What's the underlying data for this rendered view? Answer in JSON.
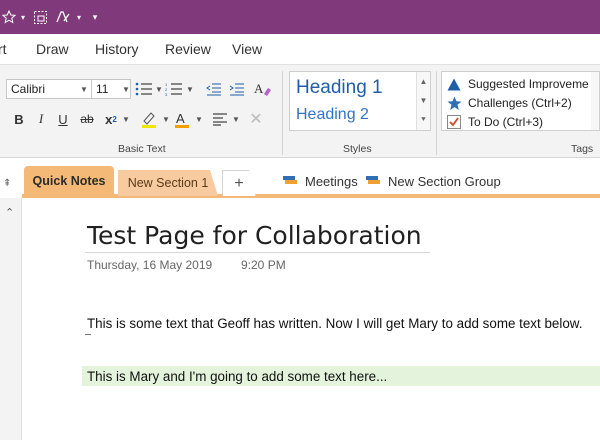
{
  "quick_access": {
    "star_icon": "star-dropdown-icon",
    "screen_clip_icon": "screen-clip-icon",
    "pen_icon": "pen-dropdown-icon",
    "customize_icon": "customize-dropdown-icon"
  },
  "menu": {
    "tabs": [
      "rt",
      "Draw",
      "History",
      "Review",
      "View"
    ]
  },
  "ribbon": {
    "basic_text": {
      "font_name": "Calibri",
      "font_size": "11",
      "label": "Basic Text",
      "bold": "B",
      "italic": "I",
      "underline": "U",
      "strike": "ab",
      "subscript": "x",
      "subscript_small": "2",
      "highlight_color": "#f2e600",
      "font_color": "#f2a000"
    },
    "styles": {
      "heading1": "Heading 1",
      "heading2": "Heading 2",
      "label": "Styles"
    },
    "tags": {
      "items": [
        {
          "label": "Suggested Improveme",
          "icon": "triangle-icon",
          "color": "#1f5ea8"
        },
        {
          "label": "Challenges (Ctrl+2)",
          "icon": "star-icon",
          "color": "#2f6fb6"
        },
        {
          "label": "To Do (Ctrl+3)",
          "icon": "checkbox-icon",
          "color": "#d24726"
        }
      ],
      "label": "Tags"
    }
  },
  "sections": {
    "pin": "⇞",
    "tabs": [
      {
        "label": "Quick Notes",
        "color": "#f5b977"
      },
      {
        "label": "New Section 1",
        "color": "#f8caa0"
      }
    ],
    "add_label": "+",
    "links": [
      {
        "label": "Meetings"
      },
      {
        "label": "New Section Group"
      }
    ]
  },
  "page": {
    "title": "Test Page for Collaboration",
    "date": "Thursday, 16 May 2019",
    "time": "9:20 PM",
    "paragraph1": "This is some text that Geoff has written. Now I will get Mary to add some text below.",
    "paragraph2": "This is Mary and I'm going to add some text here...",
    "mary_highlight": "#e4f3dc"
  },
  "colors": {
    "titlebar": "#80397b",
    "section_accent": "#f5b977"
  }
}
